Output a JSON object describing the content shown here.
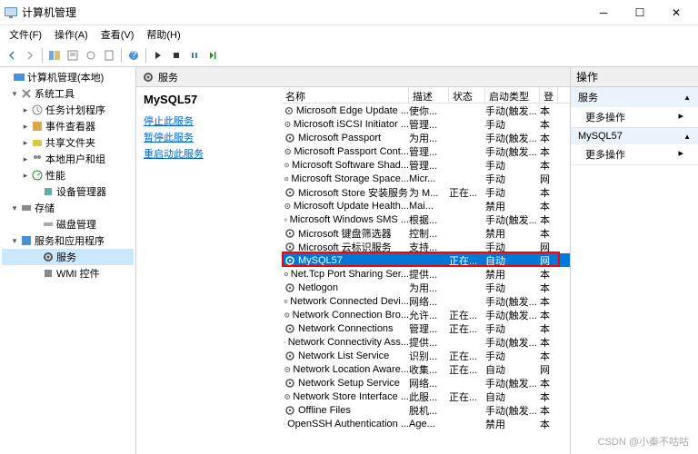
{
  "window": {
    "title": "计算机管理"
  },
  "menu": {
    "file": "文件(F)",
    "action": "操作(A)",
    "view": "查看(V)",
    "help": "帮助(H)"
  },
  "tree": {
    "root": "计算机管理(本地)",
    "system": "系统工具",
    "scheduler": "任务计划程序",
    "eventviewer": "事件查看器",
    "shared": "共享文件夹",
    "users": "本地用户和组",
    "perf": "性能",
    "devmgr": "设备管理器",
    "storage": "存储",
    "diskmgr": "磁盘管理",
    "services_app": "服务和应用程序",
    "services": "服务",
    "wmi": "WMI 控件"
  },
  "content": {
    "header": "服务"
  },
  "leftPane": {
    "heading": "MySQL57",
    "stop": "停止此服务",
    "pause": "暂停此服务",
    "restart": "重启动此服务"
  },
  "columns": {
    "name": "名称",
    "desc": "描述",
    "status": "状态",
    "startup": "启动类型",
    "logon": "登"
  },
  "services": [
    {
      "name": "Microsoft Edge Update ...",
      "desc": "使你...",
      "status": "",
      "startup": "手动(触发...",
      "logon": "本"
    },
    {
      "name": "Microsoft iSCSI Initiator ...",
      "desc": "管理...",
      "status": "",
      "startup": "手动",
      "logon": "本"
    },
    {
      "name": "Microsoft Passport",
      "desc": "为用...",
      "status": "",
      "startup": "手动(触发...",
      "logon": "本"
    },
    {
      "name": "Microsoft Passport Cont...",
      "desc": "管理...",
      "status": "",
      "startup": "手动(触发...",
      "logon": "本"
    },
    {
      "name": "Microsoft Software Shad...",
      "desc": "管理...",
      "status": "",
      "startup": "手动",
      "logon": "本"
    },
    {
      "name": "Microsoft Storage Space...",
      "desc": "Micr...",
      "status": "",
      "startup": "手动",
      "logon": "网"
    },
    {
      "name": "Microsoft Store 安装服务",
      "desc": "为 M...",
      "status": "正在...",
      "startup": "手动",
      "logon": "本"
    },
    {
      "name": "Microsoft Update Health...",
      "desc": "Mai...",
      "status": "",
      "startup": "禁用",
      "logon": "本"
    },
    {
      "name": "Microsoft Windows SMS ...",
      "desc": "根据...",
      "status": "",
      "startup": "手动(触发...",
      "logon": "本"
    },
    {
      "name": "Microsoft 键盘筛选器",
      "desc": "控制...",
      "status": "",
      "startup": "禁用",
      "logon": "本"
    },
    {
      "name": "Microsoft 云标识服务",
      "desc": "支持...",
      "status": "",
      "startup": "手动",
      "logon": "网"
    },
    {
      "name": "MySQL57",
      "desc": "",
      "status": "正在...",
      "startup": "自动",
      "logon": "网",
      "selected": true
    },
    {
      "name": "Net.Tcp Port Sharing Ser...",
      "desc": "提供...",
      "status": "",
      "startup": "禁用",
      "logon": "本"
    },
    {
      "name": "Netlogon",
      "desc": "为用...",
      "status": "",
      "startup": "手动",
      "logon": "本"
    },
    {
      "name": "Network Connected Devi...",
      "desc": "网络...",
      "status": "",
      "startup": "手动(触发...",
      "logon": "本"
    },
    {
      "name": "Network Connection Bro...",
      "desc": "允许...",
      "status": "正在...",
      "startup": "手动(触发...",
      "logon": "本"
    },
    {
      "name": "Network Connections",
      "desc": "管理...",
      "status": "正在...",
      "startup": "手动",
      "logon": "本"
    },
    {
      "name": "Network Connectivity Ass...",
      "desc": "提供...",
      "status": "",
      "startup": "手动(触发...",
      "logon": "本"
    },
    {
      "name": "Network List Service",
      "desc": "识别...",
      "status": "正在...",
      "startup": "手动",
      "logon": "本"
    },
    {
      "name": "Network Location Aware...",
      "desc": "收集...",
      "status": "正在...",
      "startup": "自动",
      "logon": "网"
    },
    {
      "name": "Network Setup Service",
      "desc": "网络...",
      "status": "",
      "startup": "手动(触发...",
      "logon": "本"
    },
    {
      "name": "Network Store Interface ...",
      "desc": "此服...",
      "status": "正在...",
      "startup": "自动",
      "logon": "本"
    },
    {
      "name": "Offline Files",
      "desc": "脱机...",
      "status": "",
      "startup": "手动(触发...",
      "logon": "本"
    },
    {
      "name": "OpenSSH Authentication ...",
      "desc": "Age...",
      "status": "",
      "startup": "禁用",
      "logon": "本"
    }
  ],
  "actions": {
    "header": "操作",
    "sec1": "服务",
    "more1": "更多操作",
    "sec2": "MySQL57",
    "more2": "更多操作"
  },
  "watermark": "CSDN @小秦不咕咕"
}
